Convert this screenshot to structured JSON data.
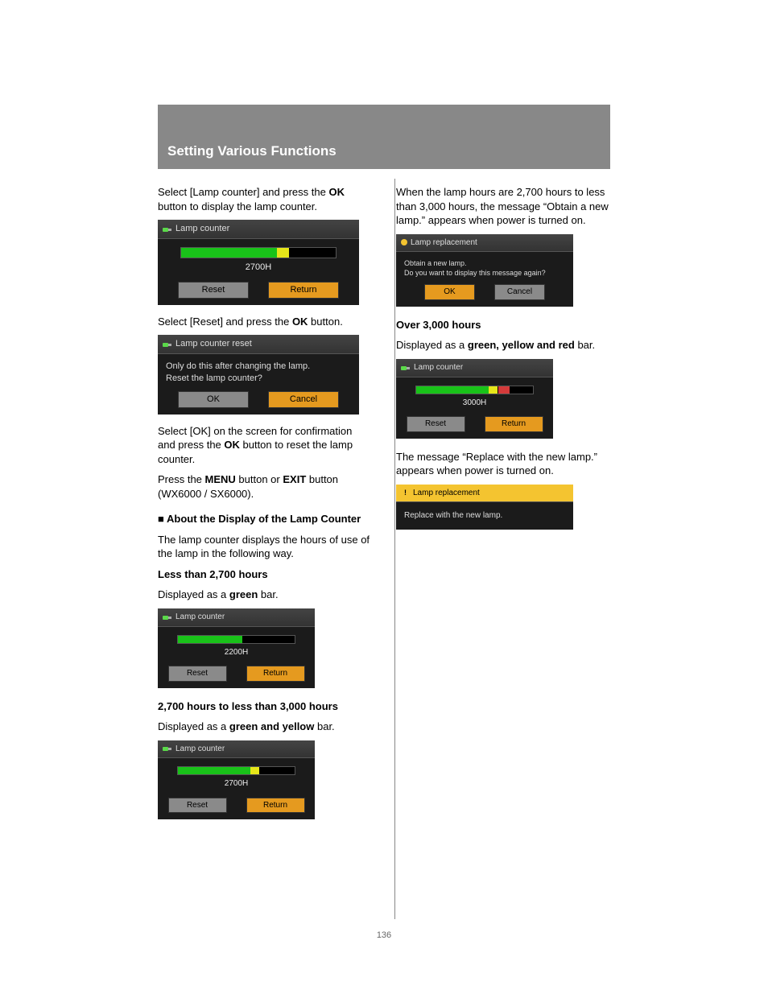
{
  "page_number": "136",
  "header": {
    "title": "Setting Various Functions"
  },
  "left": {
    "p1a": "Select [Lamp counter] and press the ",
    "p1b": "OK",
    "p1c": " button to display the lamp counter.",
    "osd1": {
      "title": "Lamp counter",
      "hours": "2700H",
      "reset": "Reset",
      "return": "Return"
    },
    "p2a": "Select [Reset] and press the ",
    "p2b": "OK",
    "p2c": " button.",
    "osd2": {
      "title": "Lamp counter reset",
      "line1": "Only do this after changing the lamp.",
      "line2": "Reset the lamp counter?",
      "ok": "OK",
      "cancel": "Cancel"
    },
    "p3a": "Select [OK] on the screen for confirmation and press the ",
    "p3b": "OK",
    "p3c": " button to reset the lamp counter.",
    "p4a": "Press the ",
    "p4b": "MENU",
    "p4c": " button or ",
    "p4d": "EXIT",
    "p4e": " button (WX6000 / SX6000).",
    "sec_about": "About the Display of the Lamp Counter",
    "p5": "The lamp counter displays the hours of use of the lamp in the following way.",
    "sub1": "Less than 2,700 hours",
    "sub1_desc_a": "Displayed as a ",
    "sub1_desc_b": "green",
    "sub1_desc_c": " bar.",
    "osd3": {
      "title": "Lamp counter",
      "hours": "2200H",
      "reset": "Reset",
      "return": "Return"
    },
    "sub2": "2,700 hours to less than 3,000 hours",
    "sub2_desc_a": "Displayed as a ",
    "sub2_desc_b": "green and yellow",
    "sub2_desc_c": " bar.",
    "osd4": {
      "title": "Lamp counter",
      "hours": "2700H",
      "reset": "Reset",
      "return": "Return"
    }
  },
  "right": {
    "p1": "When the lamp hours are 2,700 hours to less than 3,000 hours, the message “Obtain a new lamp.” appears when power is turned on.",
    "osd5": {
      "title": "Lamp replacement",
      "line1": "Obtain a new lamp.",
      "line2": "Do you want to display this message again?",
      "ok": "OK",
      "cancel": "Cancel"
    },
    "sub3": "Over 3,000 hours",
    "sub3_desc_a": "Displayed as a ",
    "sub3_desc_b": "green, yellow and red",
    "sub3_desc_c": " bar.",
    "osd6": {
      "title": "Lamp counter",
      "hours": "3000H",
      "reset": "Reset",
      "return": "Return"
    },
    "p2": "The message “Replace with the new lamp.” appears when power is turned on.",
    "osd7": {
      "title": "Lamp replacement",
      "line1": "Replace with the new lamp."
    }
  }
}
